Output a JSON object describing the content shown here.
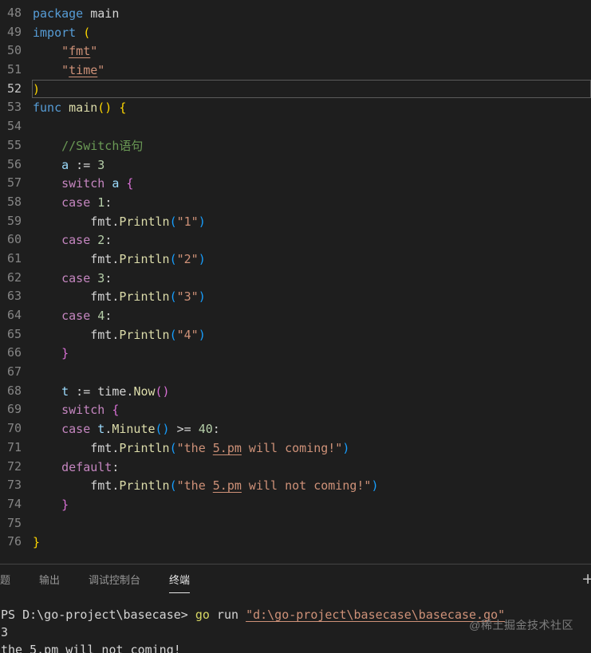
{
  "colors": {
    "background": "#1e1e1e",
    "default_text": "#d4d4d4",
    "keyword_blue": "#569cd6",
    "keyword_control_purple": "#c586c0",
    "string_orange": "#ce9178",
    "function_yellow": "#dcdcaa",
    "variable_blue": "#9cdcfe",
    "number_green": "#b5cea8",
    "comment_green": "#6a9955",
    "bracket_level1": "#ffd700",
    "bracket_level2": "#da70d6",
    "bracket_level3": "#179fff",
    "line_number": "#858585"
  },
  "editor": {
    "lines": [
      {
        "num": 48,
        "tokens": [
          [
            "kw",
            "package"
          ],
          [
            "fg",
            " main"
          ]
        ]
      },
      {
        "num": 49,
        "tokens": [
          [
            "kw",
            "import"
          ],
          [
            "fg",
            " "
          ],
          [
            "b1",
            "("
          ]
        ]
      },
      {
        "num": 50,
        "tokens": [
          [
            "fg",
            "    "
          ],
          [
            "str",
            "\""
          ],
          [
            "strU",
            "fmt"
          ],
          [
            "str",
            "\""
          ]
        ]
      },
      {
        "num": 51,
        "tokens": [
          [
            "fg",
            "    "
          ],
          [
            "str",
            "\""
          ],
          [
            "strU",
            "time"
          ],
          [
            "str",
            "\""
          ]
        ]
      },
      {
        "num": 52,
        "active": true,
        "tokens": [
          [
            "b1",
            ")"
          ]
        ]
      },
      {
        "num": 53,
        "tokens": [
          [
            "kw",
            "func"
          ],
          [
            "fg",
            " "
          ],
          [
            "fn",
            "main"
          ],
          [
            "b1",
            "()"
          ],
          [
            "fg",
            " "
          ],
          [
            "b1",
            "{"
          ]
        ]
      },
      {
        "num": 54,
        "tokens": []
      },
      {
        "num": 55,
        "tokens": [
          [
            "fg",
            "    "
          ],
          [
            "cm",
            "//Switch语句"
          ]
        ]
      },
      {
        "num": 56,
        "tokens": [
          [
            "fg",
            "    "
          ],
          [
            "var",
            "a"
          ],
          [
            "fg",
            " := "
          ],
          [
            "num",
            "3"
          ]
        ]
      },
      {
        "num": 57,
        "tokens": [
          [
            "fg",
            "    "
          ],
          [
            "ctrl",
            "switch"
          ],
          [
            "fg",
            " "
          ],
          [
            "var",
            "a"
          ],
          [
            "fg",
            " "
          ],
          [
            "b2",
            "{"
          ]
        ]
      },
      {
        "num": 58,
        "tokens": [
          [
            "fg",
            "    "
          ],
          [
            "ctrl",
            "case"
          ],
          [
            "fg",
            " "
          ],
          [
            "num",
            "1"
          ],
          [
            "fg",
            ":"
          ]
        ]
      },
      {
        "num": 59,
        "tokens": [
          [
            "fg",
            "        fmt."
          ],
          [
            "fn",
            "Println"
          ],
          [
            "b3",
            "("
          ],
          [
            "str",
            "\"1\""
          ],
          [
            "b3",
            ")"
          ]
        ]
      },
      {
        "num": 60,
        "tokens": [
          [
            "fg",
            "    "
          ],
          [
            "ctrl",
            "case"
          ],
          [
            "fg",
            " "
          ],
          [
            "num",
            "2"
          ],
          [
            "fg",
            ":"
          ]
        ]
      },
      {
        "num": 61,
        "tokens": [
          [
            "fg",
            "        fmt."
          ],
          [
            "fn",
            "Println"
          ],
          [
            "b3",
            "("
          ],
          [
            "str",
            "\"2\""
          ],
          [
            "b3",
            ")"
          ]
        ]
      },
      {
        "num": 62,
        "tokens": [
          [
            "fg",
            "    "
          ],
          [
            "ctrl",
            "case"
          ],
          [
            "fg",
            " "
          ],
          [
            "num",
            "3"
          ],
          [
            "fg",
            ":"
          ]
        ]
      },
      {
        "num": 63,
        "tokens": [
          [
            "fg",
            "        fmt."
          ],
          [
            "fn",
            "Println"
          ],
          [
            "b3",
            "("
          ],
          [
            "str",
            "\"3\""
          ],
          [
            "b3",
            ")"
          ]
        ]
      },
      {
        "num": 64,
        "tokens": [
          [
            "fg",
            "    "
          ],
          [
            "ctrl",
            "case"
          ],
          [
            "fg",
            " "
          ],
          [
            "num",
            "4"
          ],
          [
            "fg",
            ":"
          ]
        ]
      },
      {
        "num": 65,
        "tokens": [
          [
            "fg",
            "        fmt."
          ],
          [
            "fn",
            "Println"
          ],
          [
            "b3",
            "("
          ],
          [
            "str",
            "\"4\""
          ],
          [
            "b3",
            ")"
          ]
        ]
      },
      {
        "num": 66,
        "tokens": [
          [
            "fg",
            "    "
          ],
          [
            "b2",
            "}"
          ]
        ]
      },
      {
        "num": 67,
        "tokens": []
      },
      {
        "num": 68,
        "tokens": [
          [
            "fg",
            "    "
          ],
          [
            "var",
            "t"
          ],
          [
            "fg",
            " := time."
          ],
          [
            "fn",
            "Now"
          ],
          [
            "b2",
            "()"
          ]
        ]
      },
      {
        "num": 69,
        "tokens": [
          [
            "fg",
            "    "
          ],
          [
            "ctrl",
            "switch"
          ],
          [
            "fg",
            " "
          ],
          [
            "b2",
            "{"
          ]
        ]
      },
      {
        "num": 70,
        "tokens": [
          [
            "fg",
            "    "
          ],
          [
            "ctrl",
            "case"
          ],
          [
            "fg",
            " "
          ],
          [
            "var",
            "t"
          ],
          [
            "fg",
            "."
          ],
          [
            "fn",
            "Minute"
          ],
          [
            "b3",
            "()"
          ],
          [
            "fg",
            " >= "
          ],
          [
            "num",
            "40"
          ],
          [
            "fg",
            ":"
          ]
        ]
      },
      {
        "num": 71,
        "tokens": [
          [
            "fg",
            "        fmt."
          ],
          [
            "fn",
            "Println"
          ],
          [
            "b3",
            "("
          ],
          [
            "str",
            "\"the "
          ],
          [
            "strU",
            "5.pm"
          ],
          [
            "str",
            " will coming!\""
          ],
          [
            "b3",
            ")"
          ]
        ]
      },
      {
        "num": 72,
        "tokens": [
          [
            "fg",
            "    "
          ],
          [
            "ctrl",
            "default"
          ],
          [
            "fg",
            ":"
          ]
        ]
      },
      {
        "num": 73,
        "tokens": [
          [
            "fg",
            "        fmt."
          ],
          [
            "fn",
            "Println"
          ],
          [
            "b3",
            "("
          ],
          [
            "str",
            "\"the "
          ],
          [
            "strU",
            "5.pm"
          ],
          [
            "str",
            " will not coming!\""
          ],
          [
            "b3",
            ")"
          ]
        ]
      },
      {
        "num": 74,
        "tokens": [
          [
            "fg",
            "    "
          ],
          [
            "b2",
            "}"
          ]
        ]
      },
      {
        "num": 75,
        "tokens": []
      },
      {
        "num": 76,
        "tokens": [
          [
            "b1",
            "}"
          ]
        ]
      }
    ]
  },
  "panel": {
    "tabs": [
      {
        "name": "problems",
        "label": "问题",
        "active": false
      },
      {
        "name": "output",
        "label": "输出",
        "active": false
      },
      {
        "name": "debug-console",
        "label": "调试控制台",
        "active": false
      },
      {
        "name": "terminal",
        "label": "终端",
        "active": true
      }
    ],
    "plus": "+",
    "terminal": {
      "lines": [
        {
          "tokens": [
            [
              "fg",
              "PS D:\\go-project\\basecase> "
            ],
            [
              "cmd",
              "go"
            ],
            [
              "fg",
              " run "
            ],
            [
              "pathU",
              "\"d:\\go-project\\basecase\\basecase.go\""
            ]
          ]
        },
        {
          "tokens": [
            [
              "fg",
              "3"
            ]
          ]
        },
        {
          "tokens": [
            [
              "fg",
              "the 5.pm will not coming!"
            ]
          ]
        }
      ]
    }
  },
  "watermark": "@稀土掘金技术社区"
}
